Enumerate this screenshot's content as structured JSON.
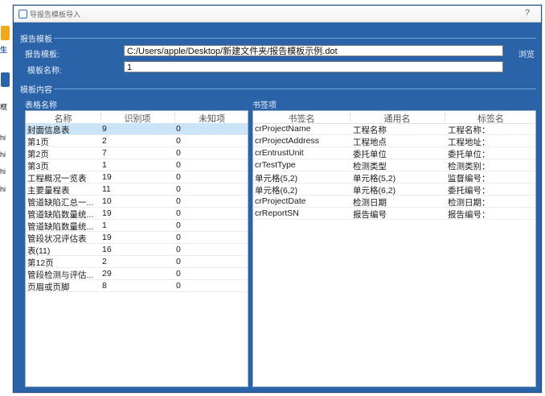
{
  "window": {
    "title": "导报告模板导入",
    "help": "?"
  },
  "background_app": {
    "letters": [
      "生",
      "框",
      "hi",
      "hi",
      "hi",
      "hi"
    ]
  },
  "template_section": {
    "group_title": "报告模板",
    "template_label": "报告模板:",
    "template_value": "C:/Users/apple/Desktop/新建文件夹/报告模板示例.dot",
    "browse_label": "浏览",
    "name_label": "模板名称:",
    "name_value": "1"
  },
  "content_section": {
    "group_title": "模板内容",
    "tables_title": "表格名称",
    "bookmarks_title": "书签项"
  },
  "tables": {
    "columns": [
      "名称",
      "识别项",
      "未知项"
    ],
    "rows": [
      {
        "name": "封面信息表",
        "recognized": "9",
        "unknown": "0",
        "selected": true
      },
      {
        "name": "第1页",
        "recognized": "2",
        "unknown": "0"
      },
      {
        "name": "第2页",
        "recognized": "7",
        "unknown": "0"
      },
      {
        "name": "第3页",
        "recognized": "1",
        "unknown": "0"
      },
      {
        "name": "工程概况一览表",
        "recognized": "19",
        "unknown": "0"
      },
      {
        "name": "主要量程表",
        "recognized": "11",
        "unknown": "0"
      },
      {
        "name": "管道缺陷汇总一...",
        "recognized": "10",
        "unknown": "0"
      },
      {
        "name": "管道缺陷数量统...",
        "recognized": "19",
        "unknown": "0"
      },
      {
        "name": "管道缺陷数量统...",
        "recognized": "1",
        "unknown": "0"
      },
      {
        "name": "管段状况评估表",
        "recognized": "19",
        "unknown": "0"
      },
      {
        "name": "表(11)",
        "recognized": "16",
        "unknown": "0"
      },
      {
        "name": "第12页",
        "recognized": "2",
        "unknown": "0"
      },
      {
        "name": "管段检测与评估...",
        "recognized": "29",
        "unknown": "0"
      },
      {
        "name": "页眉或页脚",
        "recognized": "8",
        "unknown": "0"
      }
    ]
  },
  "bookmarks": {
    "columns": [
      "书签名",
      "通用名",
      "标签名"
    ],
    "rows": [
      {
        "bookmark": "crProjectName",
        "common": "工程名称",
        "label": "工程名称："
      },
      {
        "bookmark": "crProjectAddress",
        "common": "工程地点",
        "label": "工程地址："
      },
      {
        "bookmark": "crEntrustUnit",
        "common": "委托单位",
        "label": "委托单位："
      },
      {
        "bookmark": "crTestType",
        "common": "检测类型",
        "label": "检测类别："
      },
      {
        "bookmark": "单元格(5,2)",
        "common": "单元格(5,2)",
        "label": "监督编号："
      },
      {
        "bookmark": "单元格(6,2)",
        "common": "单元格(6,2)",
        "label": "委托编号："
      },
      {
        "bookmark": "crProjectDate",
        "common": "检测日期",
        "label": "检测日期："
      },
      {
        "bookmark": "crReportSN",
        "common": "报告编号",
        "label": "报告编号："
      }
    ]
  },
  "colors": {
    "dialog_bg": "#2b63a8",
    "selection": "#cce4f7"
  }
}
